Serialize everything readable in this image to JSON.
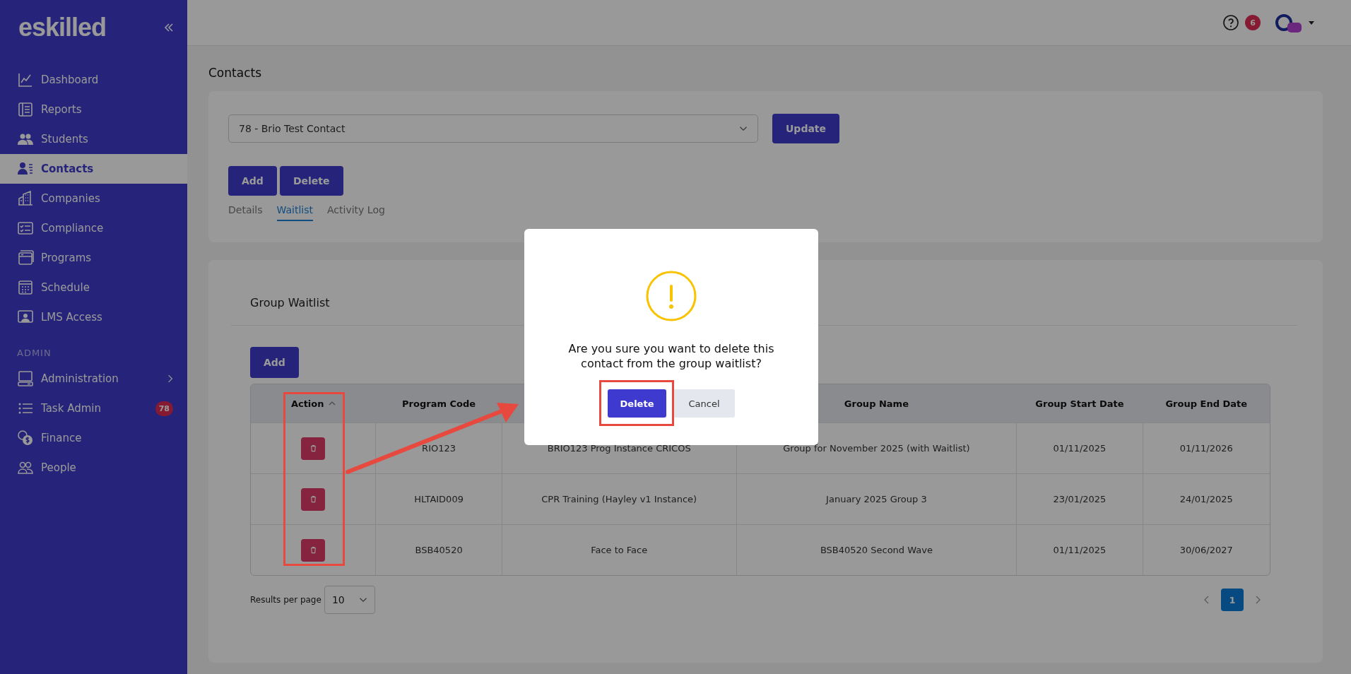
{
  "sidebar": {
    "logo": "eskilled",
    "items": [
      {
        "label": "Dashboard",
        "selected": false
      },
      {
        "label": "Reports",
        "selected": false
      },
      {
        "label": "Students",
        "selected": false
      },
      {
        "label": "Contacts",
        "selected": true
      },
      {
        "label": "Companies",
        "selected": false
      },
      {
        "label": "Compliance",
        "selected": false
      },
      {
        "label": "Programs",
        "selected": false
      },
      {
        "label": "Schedule",
        "selected": false
      },
      {
        "label": "LMS Access",
        "selected": false
      }
    ],
    "section_heading": "ADMIN",
    "admin_items": [
      {
        "label": "Administration",
        "selected": false,
        "submenu": true
      },
      {
        "label": "Task Admin",
        "selected": false,
        "submenu": false,
        "badge": "78"
      },
      {
        "label": "Finance",
        "selected": false,
        "submenu": false
      },
      {
        "label": "People",
        "selected": false,
        "submenu": false
      }
    ]
  },
  "header": {
    "notification_count": "6"
  },
  "page_title": "Contacts",
  "contact_select": {
    "value": "78 - Brio Test Contact"
  },
  "update_button": "Update",
  "actions": [
    "Add",
    "Delete"
  ],
  "tabs": [
    {
      "label": "Details",
      "selected": false
    },
    {
      "label": "Waitlist",
      "selected": true
    },
    {
      "label": "Activity Log",
      "selected": false
    }
  ],
  "waitlist": {
    "title": "Group Waitlist",
    "add_button": "Add",
    "columns": {
      "action": "Action",
      "program_code": "Program Code",
      "group_name": "Group Name",
      "group_start_date": "Group Start Date",
      "group_end_date": "Group End Date"
    },
    "rows": [
      {
        "program_code": "RIO123",
        "column_3": "BRIO123 Prog Instance CRICOS",
        "group_name": "Group for November 2025 (with Waitlist)",
        "group_start_date": "01/11/2025",
        "group_end_date": "01/11/2026"
      },
      {
        "program_code": "HLTAID009",
        "column_3": "CPR Training (Hayley v1 Instance)",
        "group_name": "January 2025 Group 3",
        "group_start_date": "23/01/2025",
        "group_end_date": "24/01/2025"
      },
      {
        "program_code": "BSB40520",
        "column_3": "Face to Face",
        "group_name": "BSB40520 Second Wave",
        "group_start_date": "01/11/2025",
        "group_end_date": "30/06/2027"
      }
    ],
    "results_per_page_label": "Results per page",
    "results_per_page": "10",
    "pages": [
      {
        "label": "1",
        "selected": true
      }
    ]
  },
  "dialog": {
    "message": "Are you sure you want to delete this contact from the group waitlist?",
    "confirm_button": "Delete",
    "cancel_button": "Cancel"
  }
}
